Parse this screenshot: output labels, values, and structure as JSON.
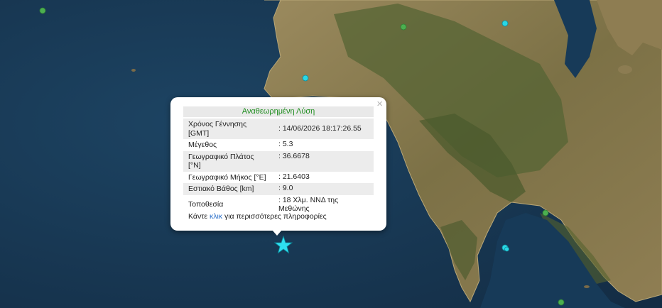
{
  "popup": {
    "title": "Αναθεωρημένη Λύση",
    "close": "×",
    "rows": [
      {
        "label": "Χρόνος Γέννησης [GMT]",
        "value": ": 14/06/2026 18:17:26.55"
      },
      {
        "label": "Μέγεθος",
        "value": ": 5.3"
      },
      {
        "label": "Γεωγραφικό Πλάτος [°N]",
        "value": ": 36.6678"
      },
      {
        "label": "Γεωγραφικό Μήκος [°E]",
        "value": ": 21.6403"
      },
      {
        "label": "Εστιακό Βάθος [km]",
        "value": ": 9.0"
      },
      {
        "label": "Τοποθεσία",
        "value": ": 18 Χλμ. ΝΝΔ της Μεθώνης"
      }
    ],
    "more_prefix": "Κάντε ",
    "more_link": "κλικ",
    "more_suffix": " για περισσότερες πληροφορίες"
  },
  "colors": {
    "sea": "#1a3a55",
    "land": "#8a7a52",
    "mountain": "#4f5e30",
    "marker_green": "#4caf50",
    "marker_cyan": "#28d7e6",
    "epicenter": "#2ee0f0",
    "title_green": "#1f8d1f",
    "link_blue": "#2a6fc9"
  },
  "markers": [
    "epicenter-star-icon",
    "earthquake-marker-green-icon",
    "earthquake-marker-cyan-icon"
  ]
}
